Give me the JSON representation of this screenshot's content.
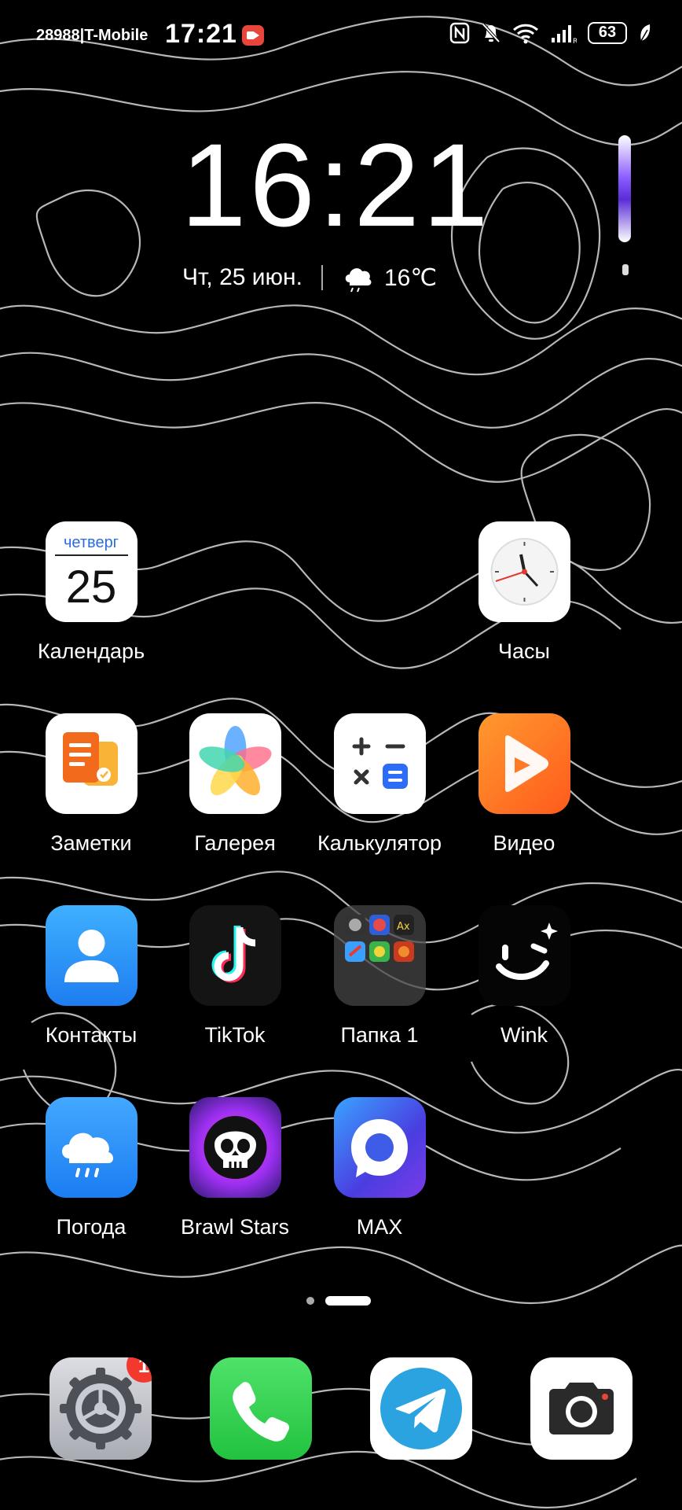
{
  "status_bar": {
    "carrier": "28988|T-Mobile",
    "time": "17:21",
    "battery": "63",
    "icons": [
      "screen-record-icon",
      "nfc-icon",
      "mute-icon",
      "wifi-icon",
      "signal-icon",
      "battery-icon",
      "leaf-icon"
    ]
  },
  "clock_widget": {
    "time": "16:21",
    "date": "Чт, 25 июн.",
    "temperature": "16℃",
    "weather_icon": "cloud-rain-icon"
  },
  "apps": [
    {
      "id": "calendar",
      "label": "Календарь",
      "weekday": "четверг",
      "day": "25"
    },
    {
      "id": "clock",
      "label": "Часы"
    },
    {
      "id": "notes",
      "label": "Заметки"
    },
    {
      "id": "gallery",
      "label": "Галерея"
    },
    {
      "id": "calculator",
      "label": "Калькулятор"
    },
    {
      "id": "video",
      "label": "Видео"
    },
    {
      "id": "contacts",
      "label": "Контакты"
    },
    {
      "id": "tiktok",
      "label": "TikTok"
    },
    {
      "id": "folder",
      "label": "Папка 1"
    },
    {
      "id": "wink",
      "label": "Wink"
    },
    {
      "id": "weather",
      "label": "Погода"
    },
    {
      "id": "brawl-stars",
      "label": "Brawl Stars"
    },
    {
      "id": "max",
      "label": "MAX"
    }
  ],
  "dock": [
    {
      "id": "settings",
      "icon": "gear-icon",
      "badge": "1"
    },
    {
      "id": "phone",
      "icon": "phone-icon"
    },
    {
      "id": "telegram",
      "icon": "telegram-icon"
    },
    {
      "id": "camera",
      "icon": "camera-icon"
    }
  ],
  "colors": {
    "background": "#000000",
    "contour_lines": "#d8d8d8",
    "badge": "#f2392e"
  }
}
